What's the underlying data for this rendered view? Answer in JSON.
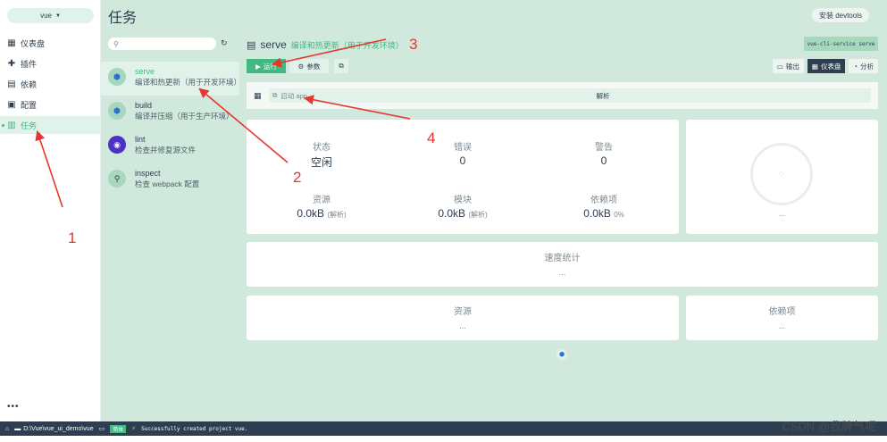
{
  "nav": {
    "project": "vue",
    "items": [
      {
        "label": "仪表盘",
        "icon": "dashboard-icon"
      },
      {
        "label": "插件",
        "icon": "plugin-icon"
      },
      {
        "label": "依赖",
        "icon": "dependency-icon"
      },
      {
        "label": "配置",
        "icon": "config-icon"
      },
      {
        "label": "任务",
        "icon": "task-icon"
      }
    ],
    "more": "•••"
  },
  "header": {
    "title": "任务",
    "devtools_button": "安装 devtools"
  },
  "tasks": [
    {
      "name": "serve",
      "desc": "编译和热更新（用于开发环境）"
    },
    {
      "name": "build",
      "desc": "编译并压缩（用于生产环境）"
    },
    {
      "name": "lint",
      "desc": "检查并修复源文件"
    },
    {
      "name": "inspect",
      "desc": "检查 webpack 配置"
    }
  ],
  "task_detail": {
    "title": "serve",
    "desc": "编译和热更新（用于开发环境）",
    "command": "vue-cli-service serve",
    "run_button": "运行",
    "params_button": "参数",
    "view_tabs": [
      "输出",
      "仪表盘",
      "分析"
    ],
    "start_app": "启动 app",
    "analyze": "解析"
  },
  "stats": {
    "status_label": "状态",
    "status_value": "空闲",
    "errors_label": "错误",
    "errors_value": "0",
    "warnings_label": "警告",
    "warnings_value": "0",
    "assets_label": "资源",
    "assets_value": "0.0kB",
    "assets_sub": "(解析)",
    "modules_label": "模块",
    "modules_value": "0.0kB",
    "modules_sub": "(解析)",
    "deps_label": "依赖项",
    "deps_value": "0.0kB",
    "deps_sub": "0%"
  },
  "progress": {
    "ellipsis": "..."
  },
  "speed": {
    "title": "速度统计",
    "dots": "..."
  },
  "assets_card": {
    "title": "资源",
    "dots": "..."
  },
  "deps_card": {
    "title": "依赖项",
    "dots": "..."
  },
  "statusbar": {
    "path": "D:\\Vue\\vue_ui_demo\\vue",
    "lang": "简体",
    "log": "Successfully created project vue."
  },
  "watermark": "CSDN @我脾气呢",
  "annotations": [
    "1",
    "2",
    "3",
    "4"
  ],
  "colors": {
    "accent": "#42b983",
    "panel": "#d1e9dd",
    "dark": "#2c3e50",
    "arrow": "#e8352e"
  }
}
